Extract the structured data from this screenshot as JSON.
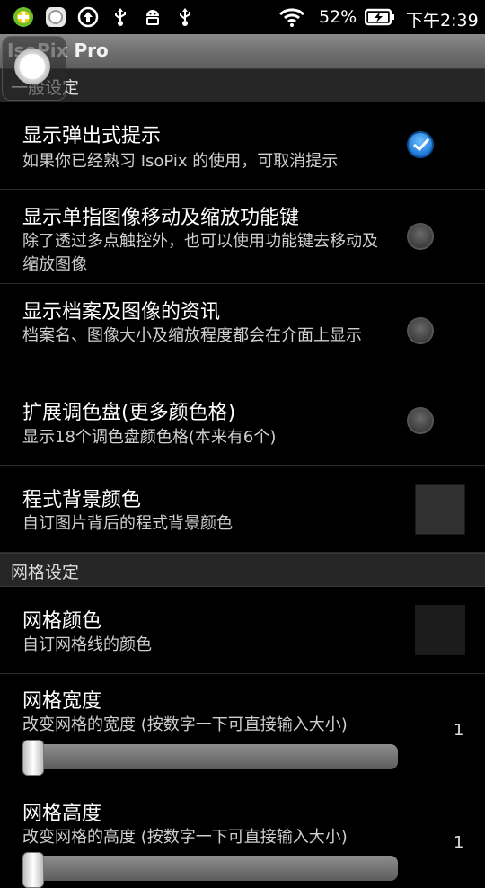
{
  "status_bar": {
    "battery": "52%",
    "time": "下午2:39",
    "icons": [
      "app-plus-icon",
      "circle-app-icon",
      "upload-icon",
      "usb-icon",
      "android-debug-icon",
      "usb-icon",
      "wifi-icon",
      "battery-charging-icon"
    ]
  },
  "app": {
    "title": "IsoPix Pro"
  },
  "sections": [
    {
      "header": "一般设定"
    },
    {
      "header": "网格设定"
    }
  ],
  "prefs": {
    "popup_hints": {
      "title": "显示弹出式提示",
      "summary": "如果你已经熟习 IsoPix 的使用，可取消提示",
      "checked": true
    },
    "single_finger_keys": {
      "title": "显示单指图像移动及缩放功能键",
      "summary": "除了透过多点触控外，也可以使用功能键去移动及缩放图像",
      "checked": false
    },
    "file_info": {
      "title": "显示档案及图像的资讯",
      "summary": "档案名、图像大小及缩放程度都会在介面上显示",
      "checked": false
    },
    "extended_palette": {
      "title": "扩展调色盘(更多颜色格)",
      "summary": "显示18个调色盘颜色格(本来有6个)",
      "checked": false
    },
    "bg_color": {
      "title": "程式背景颜色",
      "summary": "自订图片背后的程式背景颜色",
      "color": "#303030"
    },
    "grid_color": {
      "title": "网格颜色",
      "summary": "自订网格线的颜色",
      "color": "#1c1c1c"
    },
    "grid_width": {
      "title": "网格宽度",
      "summary": "改变网格的宽度 (按数字一下可直接输入大小)",
      "value": "1"
    },
    "grid_height": {
      "title": "网格高度",
      "summary": "改变网格的高度 (按数字一下可直接输入大小)",
      "value": "1"
    }
  },
  "colors": {
    "accent_checked": "#1f7bd8",
    "title_bar": "#7a7a7a"
  }
}
